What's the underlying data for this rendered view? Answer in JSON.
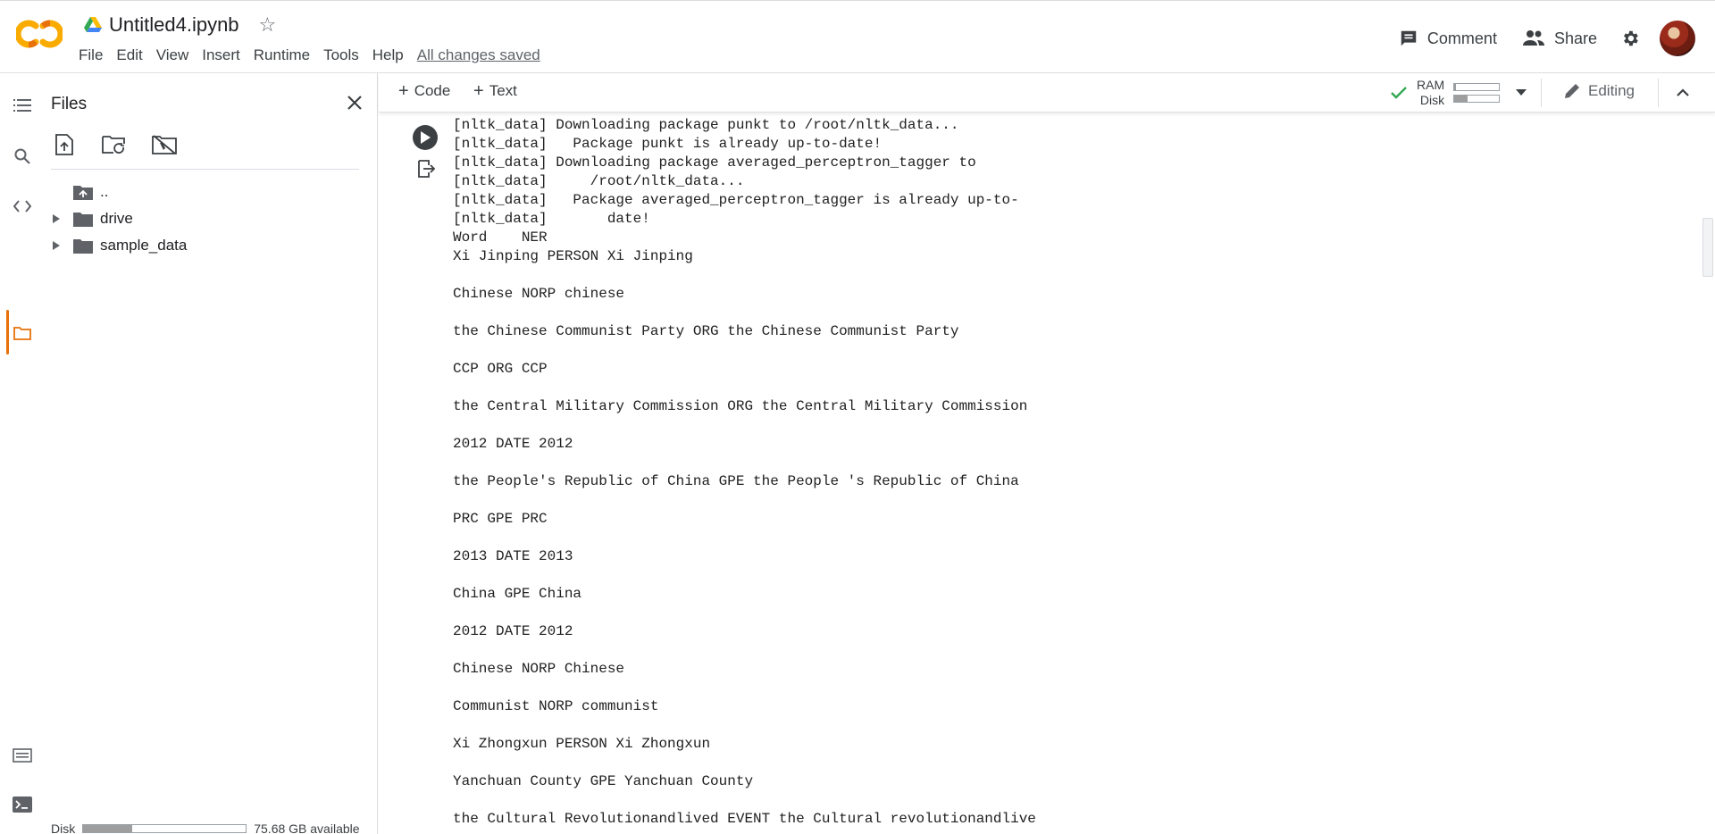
{
  "header": {
    "doc_title": "Untitled4.ipynb",
    "menu": [
      "File",
      "Edit",
      "View",
      "Insert",
      "Runtime",
      "Tools",
      "Help"
    ],
    "saved_status": "All changes saved",
    "comment_label": "Comment",
    "share_label": "Share"
  },
  "colors": {
    "logo_orange": "#F9AB00",
    "logo_dark": "#E8710A",
    "accent_check": "#34A853"
  },
  "sidebar": {
    "title": "Files",
    "tree": [
      {
        "label": "..",
        "type": "parent"
      },
      {
        "label": "drive",
        "type": "folder"
      },
      {
        "label": "sample_data",
        "type": "folder"
      }
    ],
    "disk_label": "Disk",
    "disk_available": "75.68 GB available",
    "disk_used_fraction": 0.3
  },
  "toolbar": {
    "add_code": "Code",
    "add_text": "Text",
    "ram_label": "RAM",
    "disk_label": "Disk",
    "ram_used_fraction": 0.04,
    "disk_used_fraction": 0.3,
    "mode_label": "Editing"
  },
  "cell": {
    "output_lines": [
      "[nltk_data] Downloading package punkt to /root/nltk_data...",
      "[nltk_data]   Package punkt is already up-to-date!",
      "[nltk_data] Downloading package averaged_perceptron_tagger to",
      "[nltk_data]     /root/nltk_data...",
      "[nltk_data]   Package averaged_perceptron_tagger is already up-to-",
      "[nltk_data]       date!",
      "Word    NER",
      "Xi Jinping PERSON Xi Jinping",
      "",
      "Chinese NORP chinese",
      "",
      "the Chinese Communist Party ORG the Chinese Communist Party",
      "",
      "CCP ORG CCP",
      "",
      "the Central Military Commission ORG the Central Military Commission",
      "",
      "2012 DATE 2012",
      "",
      "the People's Republic of China GPE the People 's Republic of China",
      "",
      "PRC GPE PRC",
      "",
      "2013 DATE 2013",
      "",
      "China GPE China",
      "",
      "2012 DATE 2012",
      "",
      "Chinese NORP Chinese",
      "",
      "Communist NORP communist",
      "",
      "Xi Zhongxun PERSON Xi Zhongxun",
      "",
      "Yanchuan County GPE Yanchuan County",
      "",
      "the Cultural Revolutionandlived EVENT the Cultural revolutionandlive"
    ]
  }
}
